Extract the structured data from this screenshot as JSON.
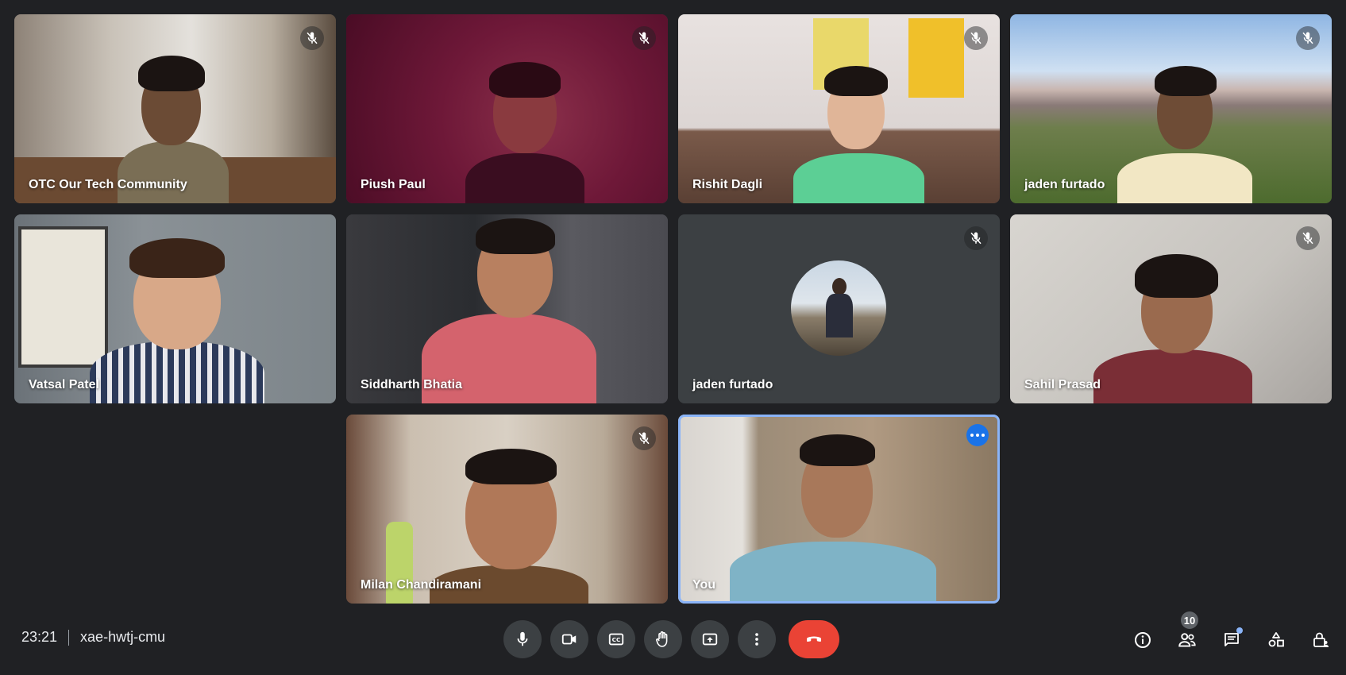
{
  "participants": [
    {
      "name": "OTC Our Tech Community",
      "muted": true
    },
    {
      "name": "Piush Paul",
      "muted": true
    },
    {
      "name": "Rishit Dagli",
      "muted": true
    },
    {
      "name": "jaden furtado",
      "muted": true
    },
    {
      "name": "Vatsal Patel",
      "muted": false
    },
    {
      "name": "Siddharth Bhatia",
      "muted": false
    },
    {
      "name": "jaden furtado",
      "muted": true
    },
    {
      "name": "Sahil Prasad",
      "muted": true
    },
    {
      "name": "Milan Chandiramani",
      "muted": true
    },
    {
      "name": "You",
      "muted": false
    }
  ],
  "meeting": {
    "time": "23:21",
    "code": "xae-hwtj-cmu"
  },
  "controls": [
    "microphone-icon",
    "camera-icon",
    "captions-icon",
    "raise-hand-icon",
    "present-icon",
    "more-options-icon",
    "end-call-icon"
  ],
  "right_panel": {
    "participant_count": "10"
  },
  "colors": {
    "background": "#202124",
    "tile": "#3c4043",
    "accent": "#8ab4f8",
    "end_call": "#ea4335",
    "self_more": "#1a73e8"
  }
}
